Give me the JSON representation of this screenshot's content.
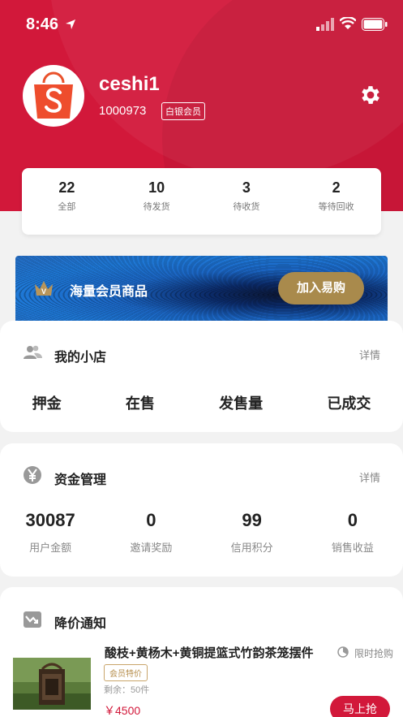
{
  "status_bar": {
    "time": "8:46"
  },
  "profile": {
    "username": "ceshi1",
    "user_id": "1000973",
    "member_level": "白银会员"
  },
  "order_stats": [
    {
      "count": "22",
      "label": "全部"
    },
    {
      "count": "10",
      "label": "待发货"
    },
    {
      "count": "3",
      "label": "待收货"
    },
    {
      "count": "2",
      "label": "等待回收"
    }
  ],
  "banner": {
    "text": "海量会员商品",
    "button": "加入易购"
  },
  "shop": {
    "title": "我的小店",
    "more": "详情",
    "items": [
      "押金",
      "在售",
      "发售量",
      "已成交"
    ]
  },
  "funds": {
    "title": "资金管理",
    "more": "详情",
    "items": [
      {
        "value": "30087",
        "label": "用户金额"
      },
      {
        "value": "0",
        "label": "邀请奖励"
      },
      {
        "value": "99",
        "label": "信用积分"
      },
      {
        "value": "0",
        "label": "销售收益"
      }
    ]
  },
  "price_alert": {
    "title": "降价通知",
    "product": {
      "name": "酸枝+黄杨木+黄铜提篮式竹韵茶笼摆件",
      "flash_label": "限时抢购",
      "tag": "会员特价",
      "remaining": "剩余：50件",
      "price": "￥4500",
      "buy_button": "马上抢"
    }
  },
  "colors": {
    "brand_red": "#d2183a",
    "gold": "#a98a4c"
  }
}
